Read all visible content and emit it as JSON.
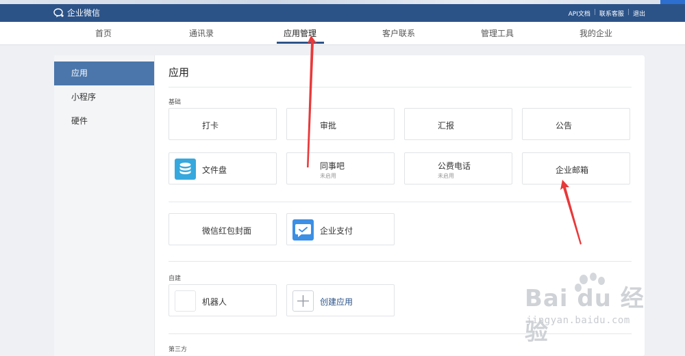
{
  "brand": {
    "name": "企业微信"
  },
  "top_links": [
    "API文档",
    "联系客服",
    "退出"
  ],
  "nav": {
    "items": [
      "首页",
      "通讯录",
      "应用管理",
      "客户联系",
      "管理工具",
      "我的企业"
    ],
    "active": "应用管理"
  },
  "sidebar": {
    "items": [
      "应用",
      "小程序",
      "硬件"
    ],
    "active": "应用"
  },
  "main": {
    "title": "应用",
    "sections": {
      "basic_label": "基础",
      "custom_label": "自建",
      "partial_label": "第三方"
    },
    "basic_apps": [
      {
        "name": "打卡"
      },
      {
        "name": "审批"
      },
      {
        "name": "汇报"
      },
      {
        "name": "公告"
      },
      {
        "name": "文件盘",
        "icon": "file-disk-icon"
      },
      {
        "name": "同事吧",
        "status": "未启用"
      },
      {
        "name": "公费电话",
        "status": "未启用"
      },
      {
        "name": "企业邮箱"
      }
    ],
    "extra_apps": [
      {
        "name": "微信红包封面"
      },
      {
        "name": "企业支付",
        "icon": "enterprise-pay-icon"
      }
    ],
    "custom_apps": [
      {
        "name": "机器人"
      },
      {
        "name": "创建应用",
        "icon": "plus-icon"
      }
    ]
  },
  "colors": {
    "topbar": "#2c5388",
    "accent": "#4a76ab",
    "annotation_arrow": "#e8393a"
  },
  "watermark": {
    "logo": "Bai du 经验",
    "url": "jingyan.baidu.com"
  }
}
